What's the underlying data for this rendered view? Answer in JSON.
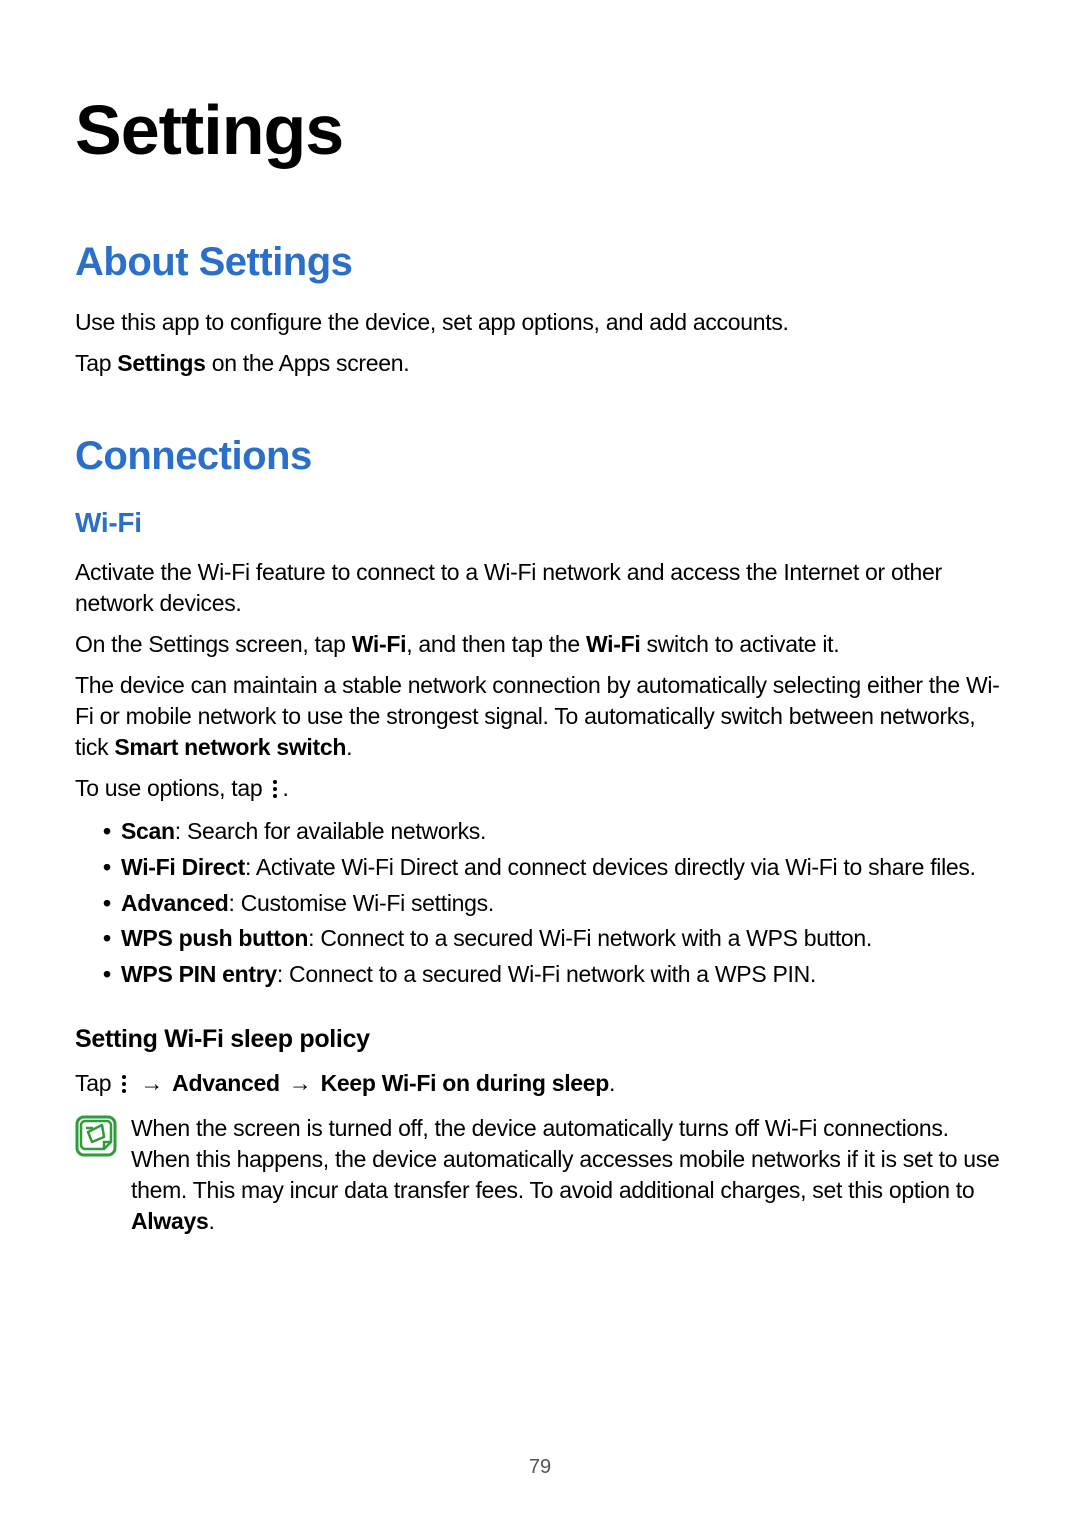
{
  "page_number": "79",
  "main_title": "Settings",
  "about": {
    "heading": "About Settings",
    "p1": "Use this app to configure the device, set app options, and add accounts.",
    "p2_prefix": "Tap ",
    "p2_bold": "Settings",
    "p2_suffix": " on the Apps screen."
  },
  "connections": {
    "heading": "Connections",
    "wifi": {
      "heading": "Wi-Fi",
      "p1": "Activate the Wi-Fi feature to connect to a Wi-Fi network and access the Internet or other network devices.",
      "p2_a": "On the Settings screen, tap ",
      "p2_b1": "Wi-Fi",
      "p2_b": ", and then tap the ",
      "p2_b2": "Wi-Fi",
      "p2_c": " switch to activate it.",
      "p3_a": "The device can maintain a stable network connection by automatically selecting either the Wi-Fi or mobile network to use the strongest signal. To automatically switch between networks, tick ",
      "p3_bold": "Smart network switch",
      "p3_b": ".",
      "p4_a": "To use options, tap ",
      "p4_b": ".",
      "options": [
        {
          "bold": "Scan",
          "text": ": Search for available networks."
        },
        {
          "bold": "Wi-Fi Direct",
          "text": ": Activate Wi-Fi Direct and connect devices directly via Wi-Fi to share files."
        },
        {
          "bold": "Advanced",
          "text": ": Customise Wi-Fi settings."
        },
        {
          "bold": "WPS push button",
          "text": ": Connect to a secured Wi-Fi network with a WPS button."
        },
        {
          "bold": "WPS PIN entry",
          "text": ": Connect to a secured Wi-Fi network with a WPS PIN."
        }
      ],
      "sleep": {
        "heading": "Setting Wi-Fi sleep policy",
        "p1_a": "Tap ",
        "p1_arrow": "→",
        "p1_b1": "Advanced",
        "p1_b2": "Keep Wi-Fi on during sleep",
        "p1_end": ".",
        "note_a": "When the screen is turned off, the device automatically turns off Wi-Fi connections. When this happens, the device automatically accesses mobile networks if it is set to use them. This may incur data transfer fees. To avoid additional charges, set this option to ",
        "note_bold": "Always",
        "note_b": "."
      }
    }
  }
}
